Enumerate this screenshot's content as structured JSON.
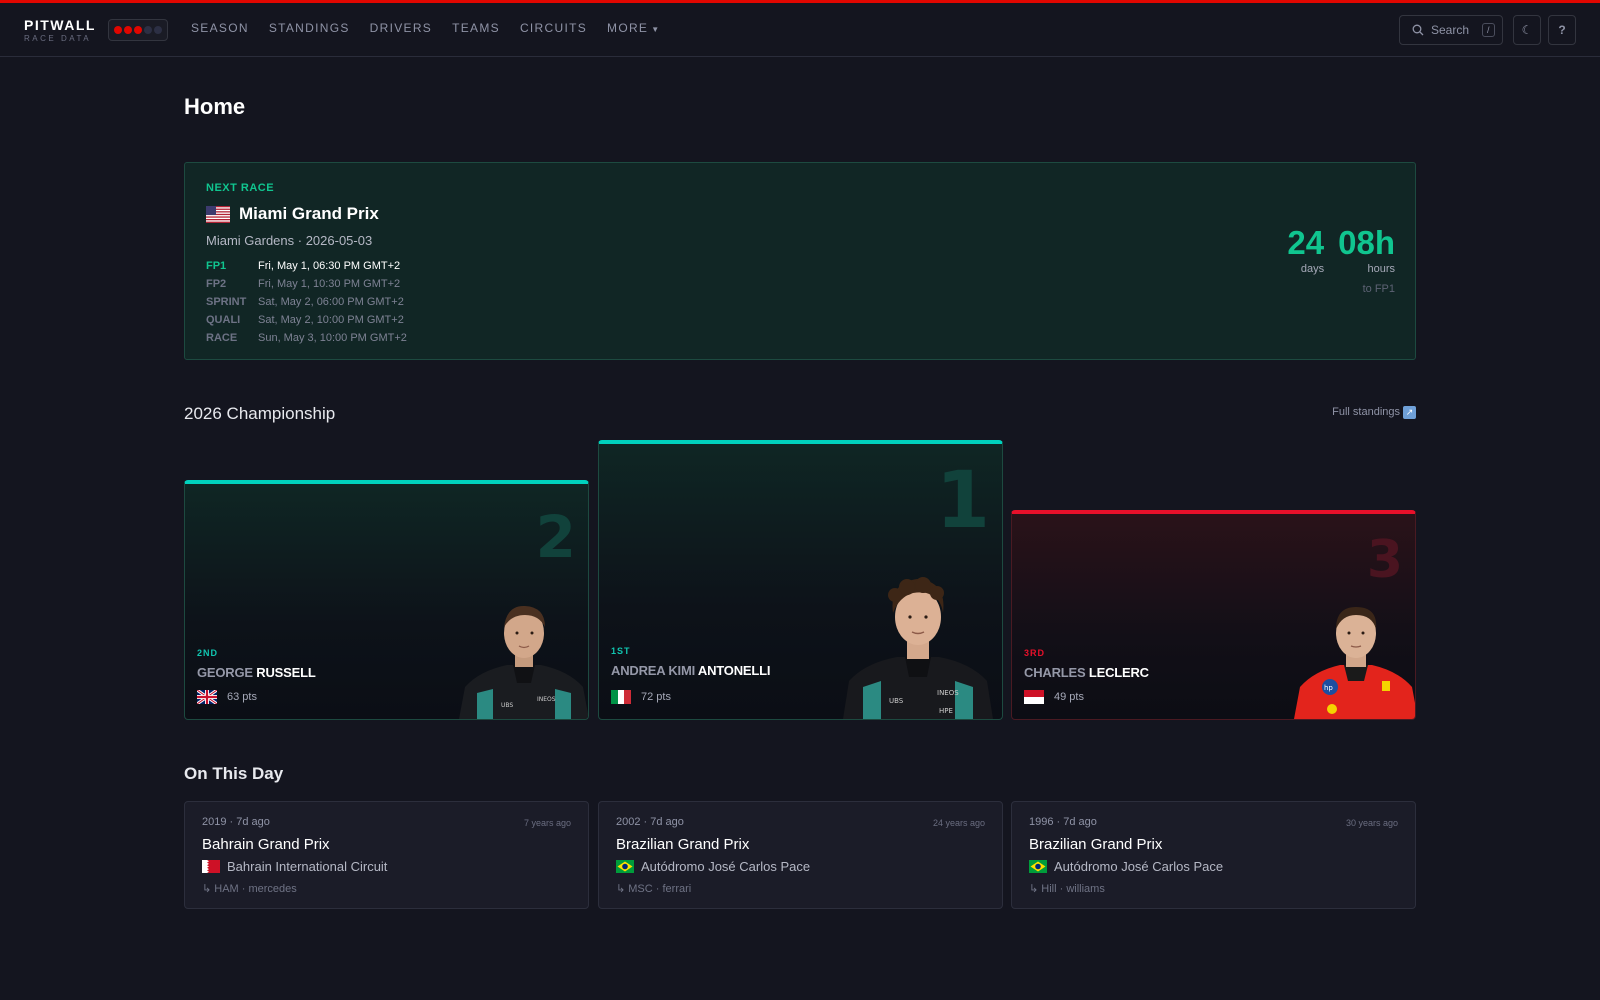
{
  "app": {
    "brand_name": "PITWALL",
    "brand_sub": "RACE DATA",
    "accent": "#e10600",
    "teal": "#10c58f"
  },
  "nav": {
    "items": [
      {
        "label": "SEASON"
      },
      {
        "label": "STANDINGS"
      },
      {
        "label": "DRIVERS"
      },
      {
        "label": "TEAMS"
      },
      {
        "label": "CIRCUITS"
      },
      {
        "label": "MORE"
      }
    ],
    "search_label": "Search",
    "search_shortcut": "/",
    "theme_icon": "moon-icon",
    "help_label": "?"
  },
  "page": {
    "title": "Home"
  },
  "next_race": {
    "label": "NEXT RACE",
    "name": "Miami Grand Prix",
    "flag": "US",
    "subtitle": "Miami Gardens · 2026-05-03",
    "sessions": [
      {
        "name": "FP1",
        "time": "Fri, May 1, 06:30 PM GMT+2",
        "active": true
      },
      {
        "name": "FP2",
        "time": "Fri, May 1, 10:30 PM GMT+2",
        "active": false
      },
      {
        "name": "SPRINT",
        "time": "Sat, May 2, 06:00 PM GMT+2",
        "active": false
      },
      {
        "name": "QUALI",
        "time": "Sat, May 2, 10:00 PM GMT+2",
        "active": false
      },
      {
        "name": "RACE",
        "time": "Sun, May 3, 10:00 PM GMT+2",
        "active": false
      }
    ],
    "countdown": {
      "days_value": "24",
      "days_label": "days",
      "hours_value": "08h",
      "hours_label": "hours",
      "target": "to FP1"
    }
  },
  "championship": {
    "title": "2026 Championship",
    "full_standings_label": "Full standings",
    "podium": [
      {
        "position_label": "2ND",
        "position_number": "2",
        "first_name": "GEORGE",
        "last_name": "RUSSELL",
        "flag": "GB",
        "points": "63 pts",
        "team_color": "#00d2be"
      },
      {
        "position_label": "1ST",
        "position_number": "1",
        "first_name": "ANDREA KIMI",
        "last_name": "ANTONELLI",
        "flag": "IT",
        "points": "72 pts",
        "team_color": "#00d2be"
      },
      {
        "position_label": "3RD",
        "position_number": "3",
        "first_name": "CHARLES",
        "last_name": "LECLERC",
        "flag": "MC",
        "points": "49 pts",
        "team_color": "#e8102a"
      }
    ]
  },
  "on_this_day": {
    "title": "On This Day",
    "items": [
      {
        "meta": "2019 · 7d ago",
        "ago": "7 years ago",
        "race": "Bahrain Grand Prix",
        "flag": "BH",
        "circuit": "Bahrain International Circuit",
        "winner": "↳ HAM · mercedes"
      },
      {
        "meta": "2002 · 7d ago",
        "ago": "24 years ago",
        "race": "Brazilian Grand Prix",
        "flag": "BR",
        "circuit": "Autódromo José Carlos Pace",
        "winner": "↳ MSC · ferrari"
      },
      {
        "meta": "1996 · 7d ago",
        "ago": "30 years ago",
        "race": "Brazilian Grand Prix",
        "flag": "BR",
        "circuit": "Autódromo José Carlos Pace",
        "winner": "↳ Hill · williams"
      }
    ]
  }
}
